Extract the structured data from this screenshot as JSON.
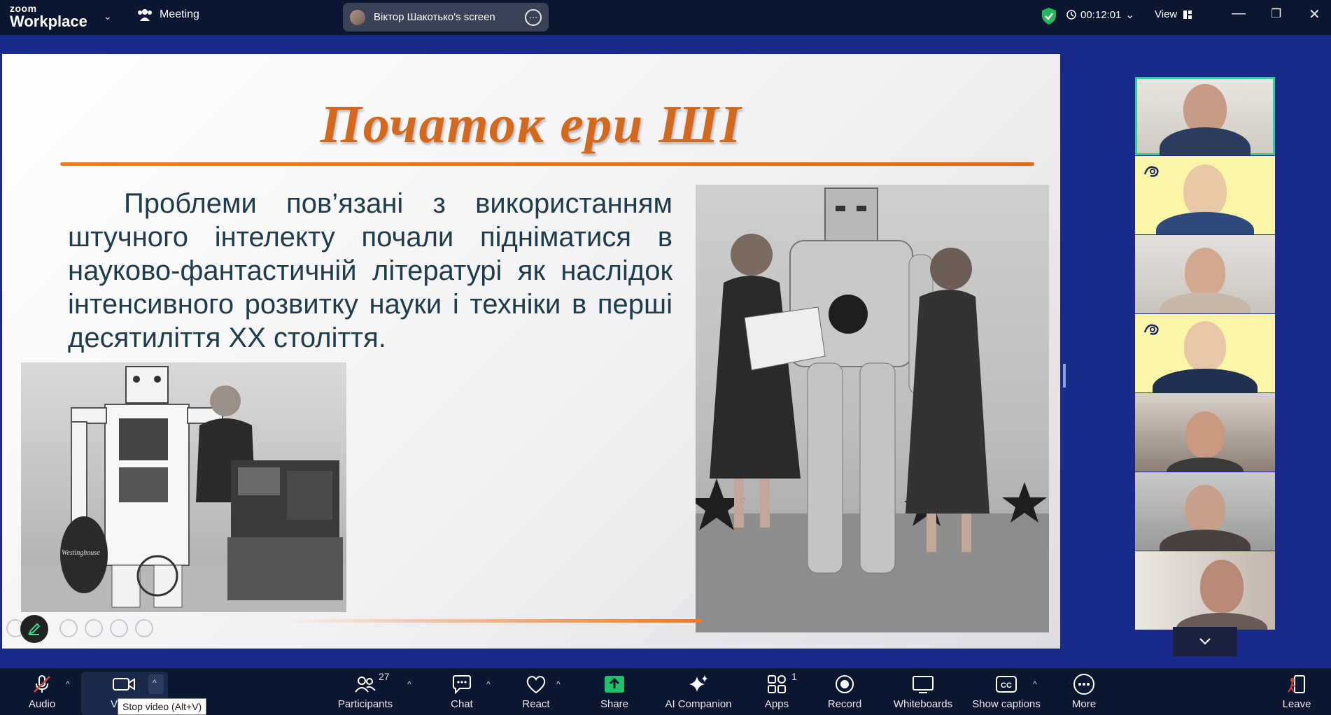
{
  "topbar": {
    "brand_small": "zoom",
    "brand_large": "Workplace",
    "meeting_label": "Meeting",
    "screen_share_label": "Віктор Шакотько's screen",
    "timer": "00:12:01",
    "view_label": "View"
  },
  "slide": {
    "title": "Початок ери ШІ",
    "body": "Проблеми пов’язані з використанням штучного інтелекту почали підніматися в науково-фантастичній літературі як наслідок інтенсивного розвитку науки і техніки в перші десятиліття XX століття.",
    "left_photo_label": "Westinghouse"
  },
  "toolbar": {
    "audio": "Audio",
    "video_tooltip": "Stop video (Alt+V)",
    "participants": "Participants",
    "participants_count": "27",
    "chat": "Chat",
    "react": "React",
    "share": "Share",
    "ai_companion": "AI Companion",
    "apps": "Apps",
    "apps_count": "1",
    "record": "Record",
    "whiteboards": "Whiteboards",
    "show_captions": "Show captions",
    "more": "More",
    "leave": "Leave",
    "cc_glyph": "CC"
  },
  "colors": {
    "accent_green": "#2ecf9a",
    "slide_title": "#d2691e",
    "share_green": "#1fc26a",
    "leave_red": "#e0433a"
  }
}
